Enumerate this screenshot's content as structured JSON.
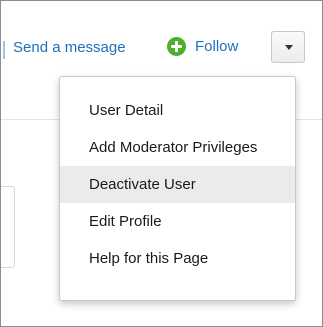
{
  "toolbar": {
    "send_message_label": "Send a message",
    "follow_label": "Follow",
    "follow_icon": "plus-circle-icon",
    "dropdown_icon": "caret-down-icon"
  },
  "colors": {
    "link": "#1f6fbf",
    "follow_icon": "#4caf2e",
    "active_item_bg": "#ebebeb"
  },
  "menu": {
    "items": [
      {
        "label": "User Detail",
        "active": false
      },
      {
        "label": "Add Moderator Privileges",
        "active": false
      },
      {
        "label": "Deactivate User",
        "active": true
      },
      {
        "label": "Edit Profile",
        "active": false
      },
      {
        "label": "Help for this Page",
        "active": false
      }
    ]
  }
}
